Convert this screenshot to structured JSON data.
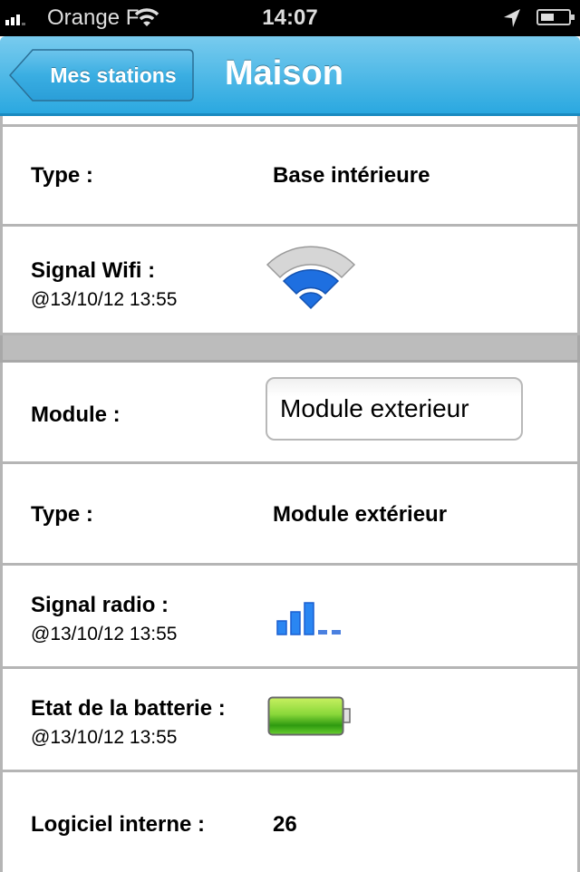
{
  "statusbar": {
    "carrier": "Orange F",
    "time": "14:07",
    "signal_bars": 3,
    "battery_level": 0.4
  },
  "navbar": {
    "back_label": "Mes stations",
    "title": "Maison"
  },
  "base": {
    "type_label": "Type :",
    "type_value": "Base intérieure",
    "wifi_label": "Signal Wifi :",
    "wifi_timestamp": "@13/10/12 13:55",
    "wifi_level": "2 of 3"
  },
  "module": {
    "module_label": "Module :",
    "module_selected": "Module exterieur",
    "type_label": "Type :",
    "type_value": "Module extérieur",
    "radio_label": "Signal radio :",
    "radio_timestamp": "@13/10/12 13:55",
    "radio_level": "3 of 5",
    "battery_label": "Etat de la batterie :",
    "battery_timestamp": "@13/10/12 13:55",
    "battery_level": "full",
    "firmware_label": "Logiciel interne :",
    "firmware_value": "26"
  },
  "colors": {
    "nav_blue": "#2aa8e0",
    "signal_blue": "#1e6fe0",
    "battery_green": "#58c01a"
  }
}
